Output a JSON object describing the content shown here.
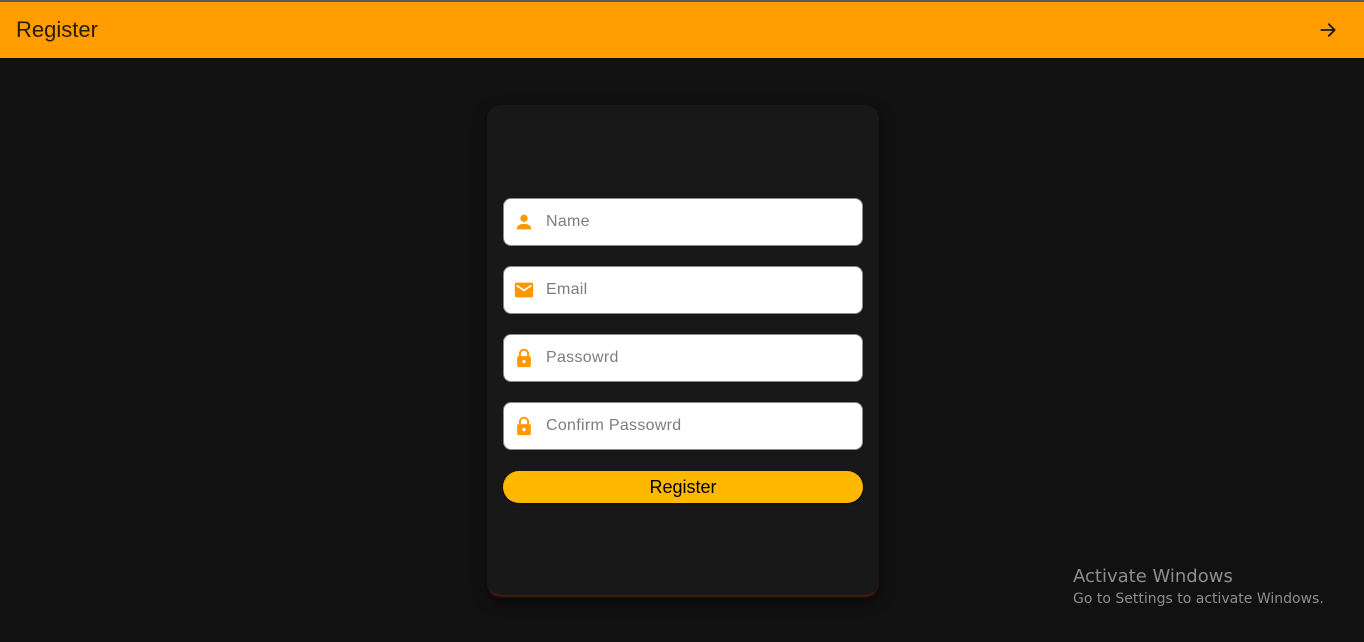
{
  "appbar": {
    "title": "Register",
    "action_icon": "arrow-right-icon",
    "background": "#ff9c00"
  },
  "form": {
    "fields": [
      {
        "icon": "person-icon",
        "placeholder": "Name",
        "value": ""
      },
      {
        "icon": "mail-icon",
        "placeholder": "Email",
        "value": ""
      },
      {
        "icon": "lock-icon",
        "placeholder": "Passowrd",
        "value": ""
      },
      {
        "icon": "lock-icon",
        "placeholder": "Confirm Passowrd",
        "value": ""
      }
    ],
    "submit_label": "Register",
    "accent": "#ff9c00",
    "button_color": "#ffb800"
  },
  "watermark": {
    "line1": "Activate Windows",
    "line2": "Go to Settings to activate Windows."
  }
}
